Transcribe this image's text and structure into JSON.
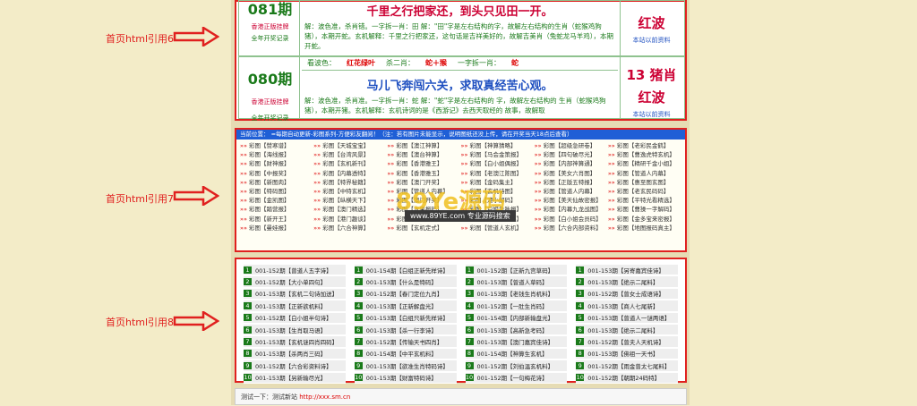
{
  "labels": {
    "l6": "首页html引用6",
    "l7": "首页html引用7",
    "l8": "首页html引用8"
  },
  "sec6": {
    "rows": [
      {
        "period": "081期",
        "sub1": "香港正版挂牌",
        "sub2": "全年开奖记录",
        "line": "",
        "slogan": "千里之行把家还，到头只见田一开。",
        "expl": "解：波色准，杀肖错。一字拆一肖：田 解：\"田\"字是左右结构的字，故解左右结构的生肖（蛇猴鸡狗猪），本期开蛇。玄机解释：千里之行把家还，这句话是吉祥美好的，故解吉美肖（兔蛇龙马羊鸡），本期开蛇。",
        "zodiac": "",
        "wave": "红波",
        "note": "本站以前资料"
      },
      {
        "period": "080期",
        "sub1": "香港正版挂牌",
        "sub2": "全年开奖记录",
        "c1": "看波色：",
        "c1v": "红花绿叶",
        "c2": "杀二肖：",
        "c2v": "蛇＋猴",
        "c3": "一字拆一肖：",
        "c3v": "蛇",
        "slogan": "马儿飞奔闯六关，求取真经苦心观。",
        "expl": "解：波色准，杀肖准。一字拆一肖：蛇 解：\"蛇\"字是左右结构的 字，故解左右结构的 生肖（蛇猴鸡狗猪），本期开猪。玄机解释：玄机诗词的是《西游记》去西天取经的 故事，故解取",
        "zodiac": "13 猪肖",
        "wave": "红波",
        "note": "本站以前资料"
      }
    ]
  },
  "sec7": {
    "bar": "当前位置： ≈每期自动更新-彩图系列-方便彩友翻阅！（注：若有图片未能显示，说明图纸还没上传，请在开奖当天18点后查看）",
    "items": [
      "彩图【赞寒谱】",
      "彩图【天城宝宝】",
      "彩图【澳江神算】",
      "彩图【神算猜略】",
      "彩图【超级急研卷】",
      "彩图【老彩民金鹤】",
      "彩图【海线报】",
      "彩图【台湾风景】",
      "彩图【澳台神算】",
      "彩图【马会金策报】",
      "彩图【四句破尽光】",
      "彩图【曹逸虎特玄机】",
      "彩图【财神报】",
      "彩图【玄机新刊】",
      "彩图【香港雅王】",
      "彩图【白小姐偶报】",
      "彩图【内部神算通】",
      "彩图【精研千金小姐】",
      "彩图【中报奖】",
      "彩图【内幕透特】",
      "彩图【香港雅玉】",
      "彩图【老澳江陈图】",
      "彩图【美女六肖图】",
      "彩图【管道人内幕】",
      "彩图【新图肉】",
      "彩图【特界秘籍】",
      "彩图【澳门开奖】",
      "彩图【金码集主】",
      "彩图【正版五特报】",
      "彩图【惠至图玄图】",
      "彩图【特码图】",
      "彩图【中特玄机】",
      "彩图【管道人内幕】",
      "彩图【玄机诗图】",
      "彩图【管道人内幕】",
      "彩图【老玄民码码】",
      "彩图【金凯图】",
      "彩图【纵横天下】",
      "彩图【澳门开奖】",
      "彩图【港小解码】",
      "彩图【美天仙故密报】",
      "彩图【平特光看精选】",
      "彩图【踏营报】",
      "彩图【澳门精选】",
      "彩图【水果报码】",
      "彩图【白姐急咏报】",
      "彩图【内幕九龙战图】",
      "彩图【曹操一字解码】",
      "彩图【新开王】",
      "彩图【港门趣谈】",
      "彩图【白姐报图】",
      "彩图【白小姐密探】",
      "彩图【白小姐会员码】",
      "彩图【金多宝来密报】",
      "彩图【曼娃报】",
      "彩图【六合神算】",
      "彩图【玄机定式】",
      "彩图【管道人玄机】",
      "彩图【六合内部资料】",
      "彩图【地图报码真主】"
    ],
    "wm": "89Ye源码",
    "wm2": "www.89YE.com 专业源码搜索"
  },
  "sec8": {
    "items": [
      "001-152期【曾道人五字诗】",
      "001-152期【大小单四句】",
      "001-153期【玄机二句诗加送】",
      "001-153期【正新欲机料】",
      "001-152期【白小姐半句诗】",
      "001-153期【生肖取马语】",
      "001-153期【玄机谜四肖四码】",
      "001-153期【杀两肖三码】",
      "001-152期【六合彩资料诗】",
      "001-153期【另新输尽光】",
      "001-154期【白组正新先样诗】",
      "001-153期【什么是特码】",
      "001-152期【春门定位九肖】",
      "001-153期【正新解盘光】",
      "001-153期【白组只新先样诗】",
      "001-153期【杀一行李诗】",
      "001-152期【传输天书四肖】",
      "001-154期【中平玄机料】",
      "001-153期【欲准生肖特码诗】",
      "001-153期【财富特码诗】",
      "001-152期【正新九宫草码】",
      "001-153期【曾道人草码】",
      "001-153期【老钱生肖机料】",
      "001-152期【一肚生肖码】",
      "001-154期【内部新输盘光】",
      "001-153期【高新急考码】",
      "001-153期【澳门嘉宾佳诗】",
      "001-154期【神算生玄机】",
      "001-152期【刘伯温玄机料】",
      "001-152期【一句梅花诗】",
      "001-153期【另寄嘉宾佳诗】",
      "001-153期【绝示二尾料】",
      "001-152期【曾女士成语诗】",
      "001-153期【商人七尾新】",
      "001-153期【曾道人一谜两语】",
      "001-153期【绝示二尾料】",
      "001-152期【曾夫人天机诗】",
      "001-153期【佛祖一天书】",
      "001-152期【雨金曾太七尾料】",
      "001-152期【朝期24码特】"
    ]
  },
  "bottom": {
    "label": "测试一下：测试新站",
    "link": "http://xxx.sm.cn"
  }
}
